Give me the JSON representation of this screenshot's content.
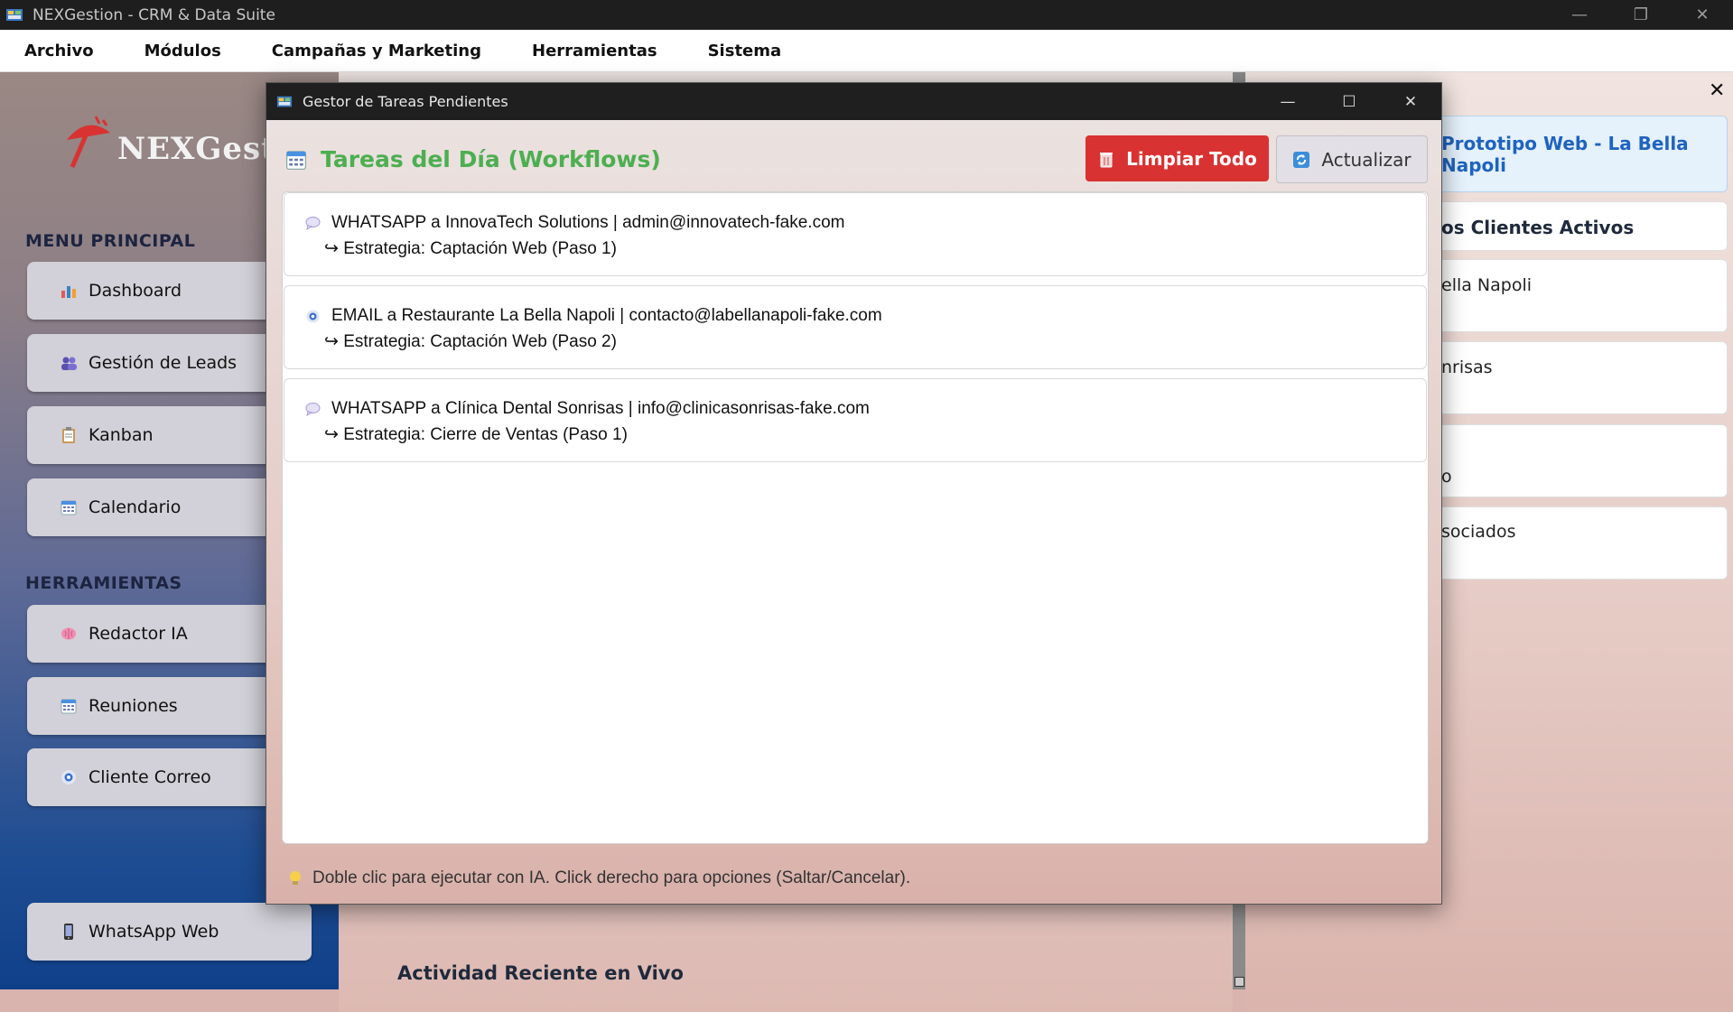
{
  "window": {
    "title": "NEXGestion - CRM & Data Suite",
    "controls": {
      "minimize": "—",
      "restore": "❐",
      "close": "✕"
    }
  },
  "menubar": [
    "Archivo",
    "Módulos",
    "Campañas y Marketing",
    "Herramientas",
    "Sistema"
  ],
  "sidebar": {
    "logo_text": "NEXGestió",
    "main_section": "MENU PRINCIPAL",
    "main_items": [
      {
        "label": "Dashboard",
        "icon": "bar-chart-icon"
      },
      {
        "label": "Gestión de Leads",
        "icon": "users-icon"
      },
      {
        "label": "Kanban",
        "icon": "clipboard-icon"
      },
      {
        "label": "Calendario",
        "icon": "calendar-icon"
      }
    ],
    "tools_section": "HERRAMIENTAS",
    "tool_items": [
      {
        "label": "Redactor IA",
        "icon": "brain-icon"
      },
      {
        "label": "Reuniones",
        "icon": "calendar-icon"
      },
      {
        "label": "Cliente Correo",
        "icon": "email-icon"
      }
    ],
    "bottom_item": {
      "label": "WhatsApp Web",
      "icon": "phone-icon"
    }
  },
  "main": {
    "activity_title": "Actividad Reciente en Vivo"
  },
  "right_panel": {
    "close": "✕",
    "highlight_title": "Prototipo Web - La Bella Napoli",
    "section_title": "os Clientes Activos",
    "items": [
      "ella Napoli",
      "nrisas",
      "o",
      "sociados"
    ]
  },
  "dialog": {
    "title": "Gestor de Tareas Pendientes",
    "controls": {
      "minimize": "—",
      "maximize": "☐",
      "close": "✕"
    },
    "heading": "Tareas del Día (Workflows)",
    "clear_button": "Limpiar Todo",
    "refresh_button": "Actualizar",
    "tasks": [
      {
        "icon": "speech-bubble-icon",
        "line1": "WHATSAPP a InnovaTech Solutions | admin@innovatech-fake.com",
        "line2": "↪ Estrategia: Captación Web (Paso 1)"
      },
      {
        "icon": "email-icon",
        "line1": "EMAIL a Restaurante La Bella Napoli | contacto@labellanapoli-fake.com",
        "line2": "↪ Estrategia: Captación Web (Paso 2)"
      },
      {
        "icon": "speech-bubble-icon",
        "line1": "WHATSAPP a Clínica Dental Sonrisas | info@clinicasonrisas-fake.com",
        "line2": "↪ Estrategia: Cierre de Ventas (Paso 1)"
      }
    ],
    "footer_hint": "Doble clic para ejecutar con IA. Click derecho para opciones (Saltar/Cancelar)."
  },
  "colors": {
    "heading_green": "#4caf50",
    "clear_red": "#d93232",
    "titlebar_dark": "#1f1f1f"
  }
}
